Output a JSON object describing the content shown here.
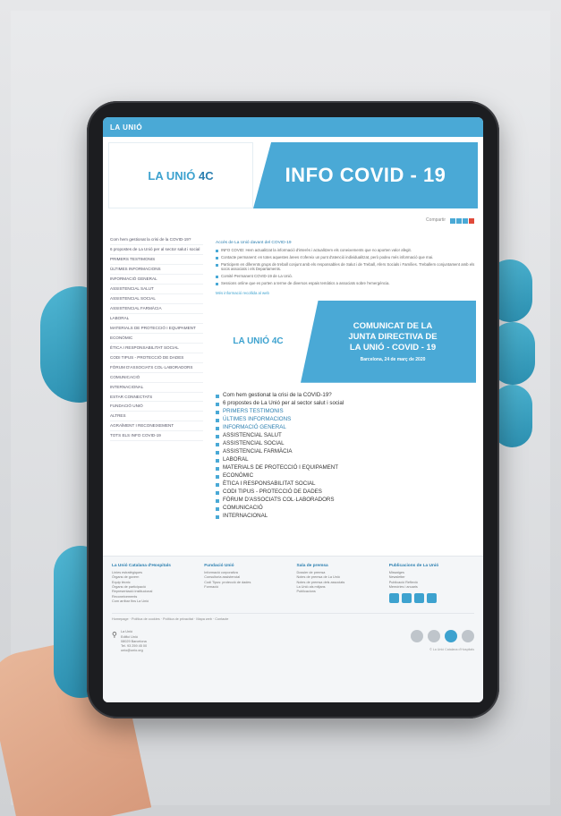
{
  "header": {
    "logo_text": "LA UNIÓ"
  },
  "hero": {
    "logo_text": "LA UNIÓ",
    "logo_number": "4C",
    "title": "INFO COVID - 19"
  },
  "share": {
    "label": "Compartir"
  },
  "sidebar": {
    "items": [
      "Com hem gestionat la crisi de la COVID-19?",
      "6 propostes de La Unió per al sector salut i social",
      "PRIMERS TESTIMONIS",
      "ÚLTIMES INFORMACIONS",
      "INFORMACIÓ GENERAL",
      "ASSISTENCIAL SALUT",
      "ASSISTENCIAL SOCIAL",
      "ASSISTENCIAL FARMÀCIA",
      "LABORAL",
      "MATERIALS DE PROTECCIÓ I EQUIPAMENT",
      "ECONÒMIC",
      "ÈTICA I RESPONSABILITAT SOCIAL",
      "CODI TIPUS - PROTECCIÓ DE DADES",
      "FÒRUM D'ASSOCIATS COL·LABORADORS",
      "COMUNICACIÓ",
      "INTERNACIONAL",
      "ESTAR CONNECTATS",
      "FUNDACIÓ UNIÓ",
      "ALTRES",
      "AGRAÏMENT I RECONEIXEMENT",
      "TOTS ELS INFO COVID-19"
    ]
  },
  "content": {
    "intro_title": "Accés de La Unió davant del COVID-19",
    "intro_bullets": [
      "INFO COVID: Hem actualitzat la informació d'interès i actualitzem els coneixements que no aporten valor afegit.",
      "Contacte permanent: en totes aquestes àrees s'ofereix un punt d'atenció individualitzat, però podeu més informació que mai.",
      "Participem en diferents grups de treball conjunt amb els responsables de Salut i de Treball, Afers Socials i Famílies. Treballem conjuntament amb els socis associats i els Departaments.",
      "Comitè Permanent COVID-19 de La Unió.",
      "Sessions online que es porten a terme de diversos espais temàtics a associats sobre l'emergència."
    ],
    "more_link": "Més informació recollida al web",
    "communique": {
      "logo_text": "LA UNIÓ 4C",
      "line1": "COMUNICAT DE LA",
      "line2": "JUNTA DIRECTIVA DE",
      "line3": "LA UNIÓ - COVID - 19",
      "date": "Barcelona, 24 de març de 2020"
    },
    "main_list": [
      "Com hem gestionat la crisi de la COVID-19?",
      "6 propostes de La Unió per al sector salut i social",
      "PRIMERS TESTIMONIS",
      "ÚLTIMES INFORMACIONS",
      "INFORMACIÓ GENERAL",
      "ASSISTENCIAL SALUT",
      "ASSISTENCIAL SOCIAL",
      "ASSISTENCIAL FARMÀCIA",
      "LABORAL",
      "MATERIALS DE PROTECCIÓ I EQUIPAMENT",
      "ECONÒMIC",
      "ÈTICA I RESPONSABILITAT SOCIAL",
      "CODI TIPUS - PROTECCIÓ DE DADES",
      "FÒRUM D'ASSOCIATS COL·LABORADORS",
      "COMUNICACIÓ",
      "INTERNACIONAL"
    ]
  },
  "footer": {
    "cols": [
      {
        "title": "La Unió Catalana d'Hospitals",
        "items": [
          "Línies estratègiques",
          "Òrgans de govern",
          "Equip tècnic",
          "Òrgans de participació",
          "Representació institucional",
          "Reconeixements",
          "Com arribar fins La Unió"
        ]
      },
      {
        "title": "Fundació Unió",
        "items": [
          "Informació corporativa",
          "Consultoria assistencial",
          "Codi Tipus: protecció de dades",
          "Formació"
        ]
      },
      {
        "title": "Sala de premsa",
        "items": [
          "Dossier de premsa",
          "Notes de premsa de La Unió",
          "Notes de premsa dels associats",
          "La Unió als mitjans",
          "Publicacions"
        ]
      },
      {
        "title": "Publicacions de La Unió",
        "items": [
          "Missatges",
          "Newsletter",
          "Publicació Reflexió",
          "Memòries i anuaris"
        ]
      }
    ],
    "links": "Homepage · Política de cookies · Política de privacitat · Mapa web · Contacte",
    "address": [
      "La Unió",
      "Edifici Unió",
      "08029 Barcelona",
      "Tel. 93 259 45 00",
      "unio@unio.org"
    ],
    "copyright": "© La Unió Catalana d'Hospitals"
  }
}
